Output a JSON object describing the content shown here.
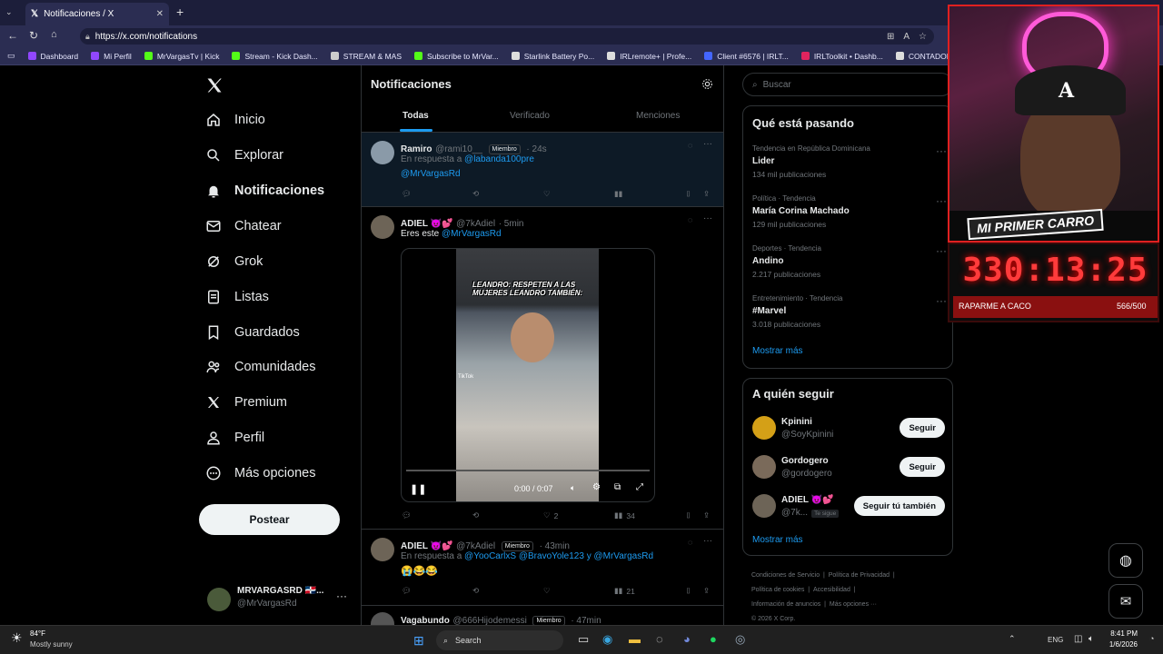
{
  "browser": {
    "tab_title": "Notificaciones / X",
    "url": "https://x.com/notifications",
    "bookmarks": [
      {
        "label": "Dashboard",
        "color": "#9147ff"
      },
      {
        "label": "Mi Perfil",
        "color": "#9147ff"
      },
      {
        "label": "MrVargasTv | Kick",
        "color": "#53fc18"
      },
      {
        "label": "Stream - Kick Dash...",
        "color": "#53fc18"
      },
      {
        "label": "STREAM & MAS",
        "color": "#cccccc"
      },
      {
        "label": "Subscribe to MrVar...",
        "color": "#53fc18"
      },
      {
        "label": "Starlink Battery Po...",
        "color": "#dddddd"
      },
      {
        "label": "IRLremote+ | Profe...",
        "color": "#dddddd"
      },
      {
        "label": "Client #6576 | IRLT...",
        "color": "#4466ff"
      },
      {
        "label": "IRLToolkit • Dashb...",
        "color": "#e0245e"
      },
      {
        "label": "CONTADOR",
        "color": "#dddddd"
      }
    ]
  },
  "nav": {
    "items": [
      {
        "label": "Inicio",
        "icon": "home-icon"
      },
      {
        "label": "Explorar",
        "icon": "search-icon"
      },
      {
        "label": "Notificaciones",
        "icon": "bell-icon"
      },
      {
        "label": "Chatear",
        "icon": "mail-icon"
      },
      {
        "label": "Grok",
        "icon": "grok-icon"
      },
      {
        "label": "Listas",
        "icon": "list-icon"
      },
      {
        "label": "Guardados",
        "icon": "bookmark-icon"
      },
      {
        "label": "Comunidades",
        "icon": "people-icon"
      },
      {
        "label": "Premium",
        "icon": "x-logo-icon"
      },
      {
        "label": "Perfil",
        "icon": "person-icon"
      },
      {
        "label": "Más opciones",
        "icon": "more-circle-icon"
      }
    ],
    "post_label": "Postear",
    "account_name": "MRVARGASRD 🇩🇴...",
    "account_handle": "@MrVargasRd"
  },
  "main": {
    "title": "Notificaciones",
    "tabs": [
      "Todas",
      "Verificado",
      "Menciones"
    ],
    "tweets": [
      {
        "name": "Ramiro",
        "handle": "@rami10__",
        "badge": "Miembro",
        "time": "· 24s",
        "reply_prefix": "En respuesta a",
        "reply_to": "@labanda100pre",
        "reply_to2": "@MrVargasRd"
      },
      {
        "name": "ADIEL 😈💕",
        "handle": "@7kAdiel",
        "time": "· 5min",
        "text": "Eres este",
        "mention": "@MrVargasRd",
        "video_caption": "LEANDRO: RESPETEN A LAS MUJERES LEANDRO TAMBIÉN:",
        "video_time": "0:00 / 0:07",
        "tiktok": "TikTok",
        "likes": "2",
        "views": "34"
      },
      {
        "name": "ADIEL 😈💕",
        "handle": "@7kAdiel",
        "badge": "Miembro",
        "time": "· 43min",
        "reply_prefix": "En respuesta a",
        "reply_to": "@YooCarlxS @BravoYole123 y @MrVargasRd",
        "emojis": "😭😂😂",
        "views": "21"
      },
      {
        "name": "Vagabundo",
        "handle": "@666Hijodemessi",
        "badge": "Miembro",
        "time": "· 47min"
      }
    ]
  },
  "right": {
    "search_placeholder": "Buscar",
    "trends_title": "Qué está pasando",
    "trends": [
      {
        "category": "Tendencia en República Dominicana",
        "title": "Lider",
        "count": "134 mil publicaciones"
      },
      {
        "category": "Política · Tendencia",
        "title": "María Corina Machado",
        "count": "129 mil publicaciones"
      },
      {
        "category": "Deportes · Tendencia",
        "title": "Andino",
        "count": "2.217 publicaciones"
      },
      {
        "category": "Entretenimiento · Tendencia",
        "title": "#Marvel",
        "count": "3.018 publicaciones"
      }
    ],
    "show_more": "Mostrar más",
    "follow_title": "A quién seguir",
    "follow": [
      {
        "name": "Kpinini",
        "handle": "@SoyKpinini",
        "button": "Seguir"
      },
      {
        "name": "Gordogero",
        "handle": "@gordogero",
        "button": "Seguir"
      },
      {
        "name": "ADIEL 😈💕",
        "handle": "@7k...",
        "tag": "Te sigue",
        "button": "Seguir tú también"
      }
    ],
    "footer": [
      "Condiciones de Servicio",
      "Política de Privacidad",
      "Política de cookies",
      "Accesibilidad",
      "Información de anuncios",
      "Más opciones ···",
      "© 2026 X Corp."
    ]
  },
  "overlay": {
    "banner": "MI PRIMER CARRO",
    "timer": "330:13:25",
    "goal_label": "RAPARME A CACO",
    "goal_count": "566/500",
    "accent": "#ff2a2a"
  },
  "taskbar": {
    "temp": "84°F",
    "weather": "Mostly sunny",
    "search": "Search",
    "lang": "ENG",
    "time": "8:41 PM",
    "date": "1/6/2026"
  }
}
